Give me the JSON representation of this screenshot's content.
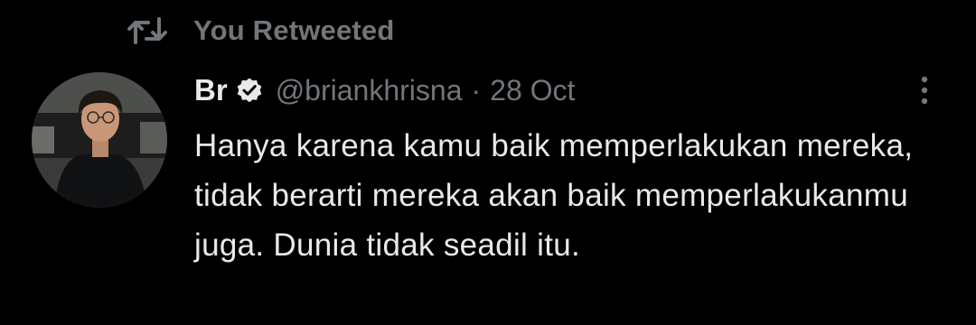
{
  "retweet": {
    "label": "You Retweeted",
    "icon": "retweet-icon"
  },
  "tweet": {
    "display_name": "Br",
    "verified_icon": "verified-badge-icon",
    "handle": "@briankhrisna",
    "separator": "·",
    "date": "28 Oct",
    "text": "Hanya karena kamu baik memperlakukan mereka, tidak berarti mereka akan baik memperlakukanmu juga. Dunia tidak seadil itu.",
    "more_icon": "more-options-icon"
  },
  "colors": {
    "background": "#000000",
    "primary_text": "#e7e9ea",
    "secondary_text": "#71767b"
  }
}
